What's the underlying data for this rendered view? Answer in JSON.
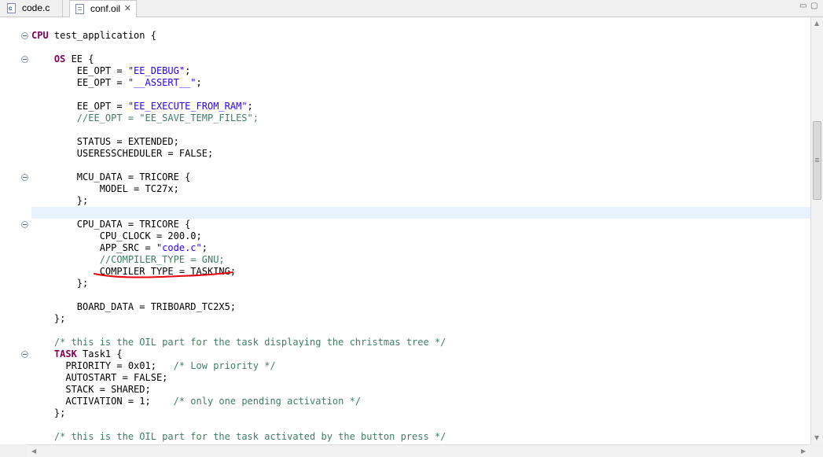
{
  "tabs": [
    {
      "label": "code.c",
      "icon": "c-file-icon",
      "active": false
    },
    {
      "label": "conf.oil",
      "icon": "text-file-icon",
      "active": true,
      "close_glyph": "✕"
    }
  ],
  "window_controls": {
    "minimize_glyph": "▭",
    "maximize_glyph": "▢"
  },
  "colors": {
    "keyword": "#7f0055",
    "string": "#2a00ff",
    "comment": "#3f7f5f",
    "current_line": "#e8f2fe",
    "annotation": "#e8000d"
  },
  "code": {
    "lines": [
      {
        "fold": true,
        "parts": [
          {
            "t": "CPU",
            "c": "kw"
          },
          {
            "t": " test_application {"
          }
        ]
      },
      {
        "fold": false,
        "parts": [
          {
            "t": ""
          }
        ]
      },
      {
        "fold": true,
        "parts": [
          {
            "t": "    "
          },
          {
            "t": "OS",
            "c": "kw"
          },
          {
            "t": " EE {"
          }
        ]
      },
      {
        "fold": false,
        "parts": [
          {
            "t": "        EE_OPT = "
          },
          {
            "t": "\"EE_DEBUG\"",
            "c": "str"
          },
          {
            "t": ";"
          }
        ]
      },
      {
        "fold": false,
        "parts": [
          {
            "t": "        EE_OPT = "
          },
          {
            "t": "\"__ASSERT__\"",
            "c": "str"
          },
          {
            "t": ";"
          }
        ]
      },
      {
        "fold": false,
        "parts": [
          {
            "t": ""
          }
        ]
      },
      {
        "fold": false,
        "parts": [
          {
            "t": "        EE_OPT = "
          },
          {
            "t": "\"EE_EXECUTE_FROM_RAM\"",
            "c": "str"
          },
          {
            "t": ";"
          }
        ]
      },
      {
        "fold": false,
        "parts": [
          {
            "t": "        "
          },
          {
            "t": "//EE_OPT = \"EE_SAVE_TEMP_FILES\";",
            "c": "cmt"
          }
        ]
      },
      {
        "fold": false,
        "parts": [
          {
            "t": ""
          }
        ]
      },
      {
        "fold": false,
        "parts": [
          {
            "t": "        STATUS = EXTENDED;"
          }
        ]
      },
      {
        "fold": false,
        "parts": [
          {
            "t": "        USERESSCHEDULER = FALSE;"
          }
        ]
      },
      {
        "fold": false,
        "parts": [
          {
            "t": ""
          }
        ]
      },
      {
        "fold": true,
        "parts": [
          {
            "t": "        MCU_DATA = TRICORE {"
          }
        ]
      },
      {
        "fold": false,
        "parts": [
          {
            "t": "            MODEL = TC27x;"
          }
        ]
      },
      {
        "fold": false,
        "parts": [
          {
            "t": "        };"
          }
        ]
      },
      {
        "fold": false,
        "parts": [
          {
            "t": ""
          }
        ]
      },
      {
        "fold": true,
        "parts": [
          {
            "t": "        CPU_DATA = TRICORE {"
          }
        ]
      },
      {
        "fold": false,
        "parts": [
          {
            "t": "            CPU_CLOCK = 200.0;"
          }
        ]
      },
      {
        "fold": false,
        "parts": [
          {
            "t": "            APP_SRC = "
          },
          {
            "t": "\"code.c\"",
            "c": "str"
          },
          {
            "t": ";"
          }
        ]
      },
      {
        "fold": false,
        "parts": [
          {
            "t": "            "
          },
          {
            "t": "//COMPILER_TYPE = GNU;",
            "c": "cmt"
          }
        ]
      },
      {
        "fold": false,
        "parts": [
          {
            "t": "            COMPILER_TYPE = TASKING;"
          }
        ]
      },
      {
        "fold": false,
        "parts": [
          {
            "t": "        };"
          }
        ]
      },
      {
        "fold": false,
        "parts": [
          {
            "t": ""
          }
        ]
      },
      {
        "fold": false,
        "parts": [
          {
            "t": "        BOARD_DATA = TRIBOARD_TC2X5;"
          }
        ]
      },
      {
        "fold": false,
        "parts": [
          {
            "t": "    };"
          }
        ]
      },
      {
        "fold": false,
        "parts": [
          {
            "t": ""
          }
        ]
      },
      {
        "fold": false,
        "parts": [
          {
            "t": "    "
          },
          {
            "t": "/* this is the OIL part for the task displaying the christmas tree */",
            "c": "cmt"
          }
        ]
      },
      {
        "fold": true,
        "parts": [
          {
            "t": "    "
          },
          {
            "t": "TASK",
            "c": "kw"
          },
          {
            "t": " Task1 {"
          }
        ]
      },
      {
        "fold": false,
        "parts": [
          {
            "t": "      PRIORITY = 0x01;   "
          },
          {
            "t": "/* Low priority */",
            "c": "cmt"
          }
        ]
      },
      {
        "fold": false,
        "parts": [
          {
            "t": "      AUTOSTART = FALSE;"
          }
        ]
      },
      {
        "fold": false,
        "parts": [
          {
            "t": "      STACK = SHARED;"
          }
        ]
      },
      {
        "fold": false,
        "parts": [
          {
            "t": "      ACTIVATION = 1;    "
          },
          {
            "t": "/* only one pending activation */",
            "c": "cmt"
          }
        ]
      },
      {
        "fold": false,
        "parts": [
          {
            "t": "    };"
          }
        ]
      },
      {
        "fold": false,
        "parts": [
          {
            "t": ""
          }
        ]
      },
      {
        "fold": false,
        "parts": [
          {
            "t": "    "
          },
          {
            "t": "/* this is the OIL part for the task activated by the button press */",
            "c": "cmt"
          }
        ]
      }
    ]
  },
  "scrollbar": {
    "left_arrow": "◀",
    "right_arrow": "▶",
    "up_arrow": "▲",
    "down_arrow": "▼"
  }
}
